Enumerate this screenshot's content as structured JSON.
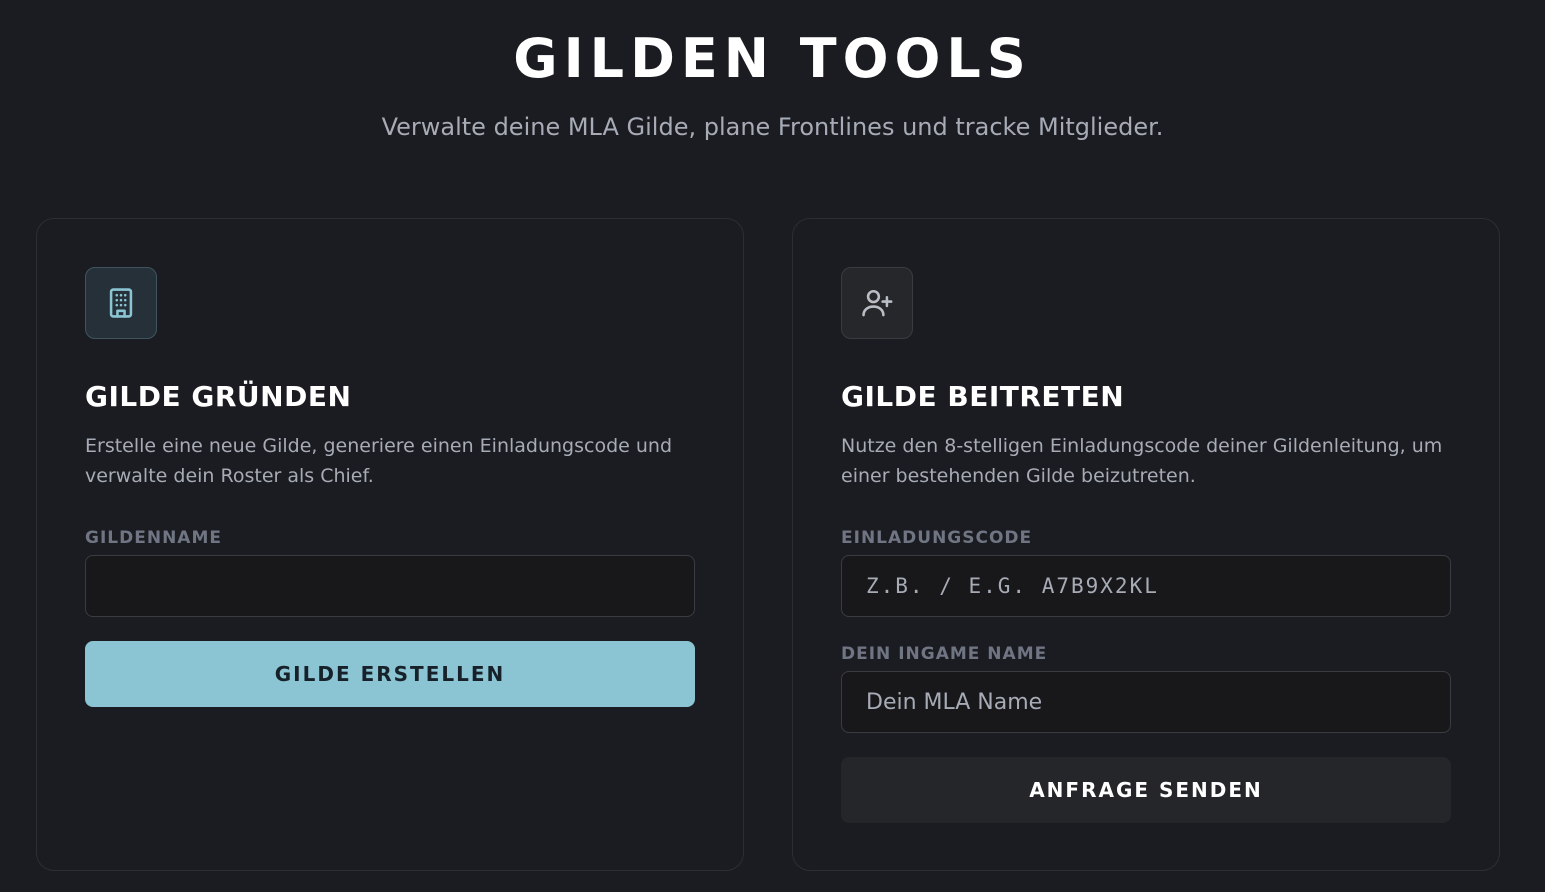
{
  "header": {
    "title": "GILDEN TOOLS",
    "subtitle": "Verwalte deine MLA Gilde, plane Frontlines und tracke Mitglieder."
  },
  "create_card": {
    "icon": "building-icon",
    "title": "GILDE GRÜNDEN",
    "description": "Erstelle eine neue Gilde, generiere einen Einladungscode und verwalte dein Roster als Chief.",
    "guild_name_label": "GILDENNAME",
    "guild_name_value": "",
    "button_label": "GILDE ERSTELLEN"
  },
  "join_card": {
    "icon": "user-plus-icon",
    "title": "GILDE BEITRETEN",
    "description": "Nutze den 8-stelligen Einladungscode deiner Gildenleitung, um einer bestehenden Gilde beizutreten.",
    "invite_code_label": "EINLADUNGSCODE",
    "invite_code_placeholder": "Z.B. / E.G. A7B9X2KL",
    "ingame_name_label": "DEIN INGAME NAME",
    "ingame_name_placeholder": "Dein MLA Name",
    "button_label": "ANFRAGE SENDEN"
  },
  "colors": {
    "background": "#1b1c21",
    "accent": "#8bc4d3",
    "card_border": "#2c2e34",
    "muted_text": "#a6abb6",
    "label_text": "#6f7582"
  }
}
